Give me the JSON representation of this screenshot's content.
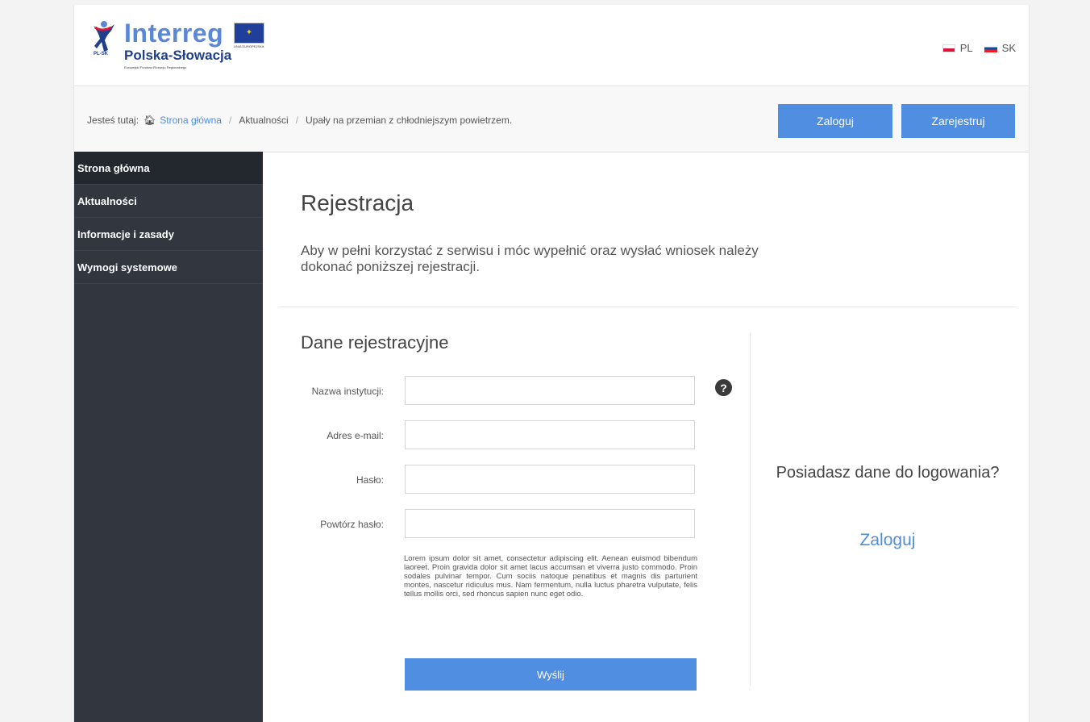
{
  "header": {
    "logo_word": "Interreg",
    "logo_sub": "Polska-Słowacja",
    "logo_tiny": "Europejski Fundusz Rozwoju Regionalnego",
    "logo_code": "PL-SK",
    "eu_label": "UNIA EUROPEJSKA",
    "languages": [
      {
        "code": "PL",
        "flag": "pl-flag-icon"
      },
      {
        "code": "SK",
        "flag": "sk-flag-icon"
      }
    ]
  },
  "breadcrumb": {
    "prefix": "Jesteś tutaj:",
    "items": [
      "Strona główna",
      "Aktualności",
      "Upały na przemian z chłodniejszym powietrzem."
    ],
    "separator": "/",
    "home_icon": "home-icon"
  },
  "auth": {
    "login_label": "Zaloguj",
    "register_label": "Zarejestruj"
  },
  "sidebar": {
    "items": [
      {
        "label": "Strona główna"
      },
      {
        "label": "Aktualności"
      },
      {
        "label": "Informacje i zasady"
      },
      {
        "label": "Wymogi systemowe"
      }
    ]
  },
  "main": {
    "title": "Rejestracja",
    "intro": "Aby w pełni korzystać z serwisu i móc wypełnić oraz wysłać wniosek należy dokonać poniższej rejestracji.",
    "form_title": "Dane rejestracyjne",
    "fields": [
      {
        "label": "Nazwa instytucji:",
        "value": ""
      },
      {
        "label": "Adres e-mail:",
        "value": ""
      },
      {
        "label": "Hasło:",
        "value": ""
      },
      {
        "label": "Powtórz hasło:",
        "value": ""
      }
    ],
    "help_symbol": "?",
    "lorem": "Lorem ipsum dolor sit amet, consectetur adipiscing elit. Aenean euismod bibendum laoreet. Proin gravida dolor sit amet lacus accumsan et viverra justo commodo. Proin sodales pulvinar tempor. Cum sociis natoque penatibus et magnis dis parturient montes, nascetur ridiculus mus. Nam fermentum, nulla luctus pharetra vulputate, felis tellus mollis orci, sed rhoncus sapien nunc eget odio.",
    "submit_label": "Wyślij",
    "side_question": "Posiadasz dane do logowania?",
    "side_login": "Zaloguj"
  },
  "colors": {
    "accent": "#4f8ee0",
    "sidebar_bg": "#31363f",
    "sidebar_active": "#23272e",
    "link": "#4f8ddf"
  }
}
